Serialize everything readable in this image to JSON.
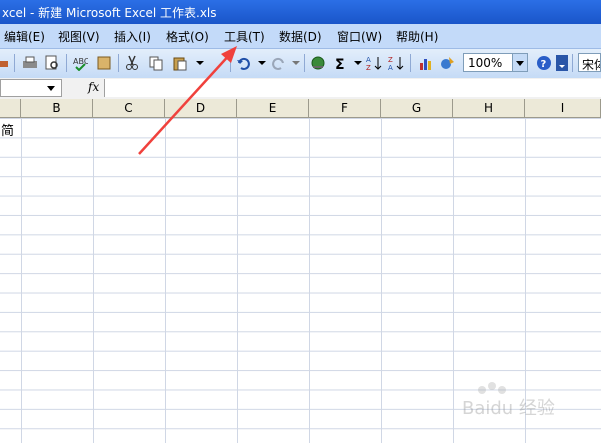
{
  "window": {
    "title": "xcel - 新建 Microsoft Excel 工作表.xls"
  },
  "menu": {
    "items": [
      {
        "label": "编辑(E)",
        "name": "menu-edit"
      },
      {
        "label": "视图(V)",
        "name": "menu-view"
      },
      {
        "label": "插入(I)",
        "name": "menu-insert"
      },
      {
        "label": "格式(O)",
        "name": "menu-format"
      },
      {
        "label": "工具(T)",
        "name": "menu-tools"
      },
      {
        "label": "数据(D)",
        "name": "menu-data"
      },
      {
        "label": "窗口(W)",
        "name": "menu-window"
      },
      {
        "label": "帮助(H)",
        "name": "menu-help"
      }
    ]
  },
  "toolbar": {
    "zoom": "100%",
    "font": "宋体",
    "icons": [
      "print-icon",
      "print-preview-icon",
      "spelling-icon",
      "research-icon",
      "cut-icon",
      "copy-icon",
      "paste-icon",
      "format-painter-icon",
      "undo-icon",
      "redo-icon",
      "hyperlink-icon",
      "autosum-icon",
      "sort-ascending-icon",
      "sort-descending-icon",
      "chart-wizard-icon",
      "drawing-icon",
      "help-icon"
    ]
  },
  "formula_bar": {
    "fx": "fx",
    "name_box": "",
    "content": ""
  },
  "sheet": {
    "columns": [
      "B",
      "C",
      "D",
      "E",
      "F",
      "G",
      "H",
      "I"
    ],
    "cell_text": "简"
  },
  "annotation": {
    "arrow_color": "#f0413c"
  },
  "watermark": {
    "text": "Baidu 经验"
  }
}
